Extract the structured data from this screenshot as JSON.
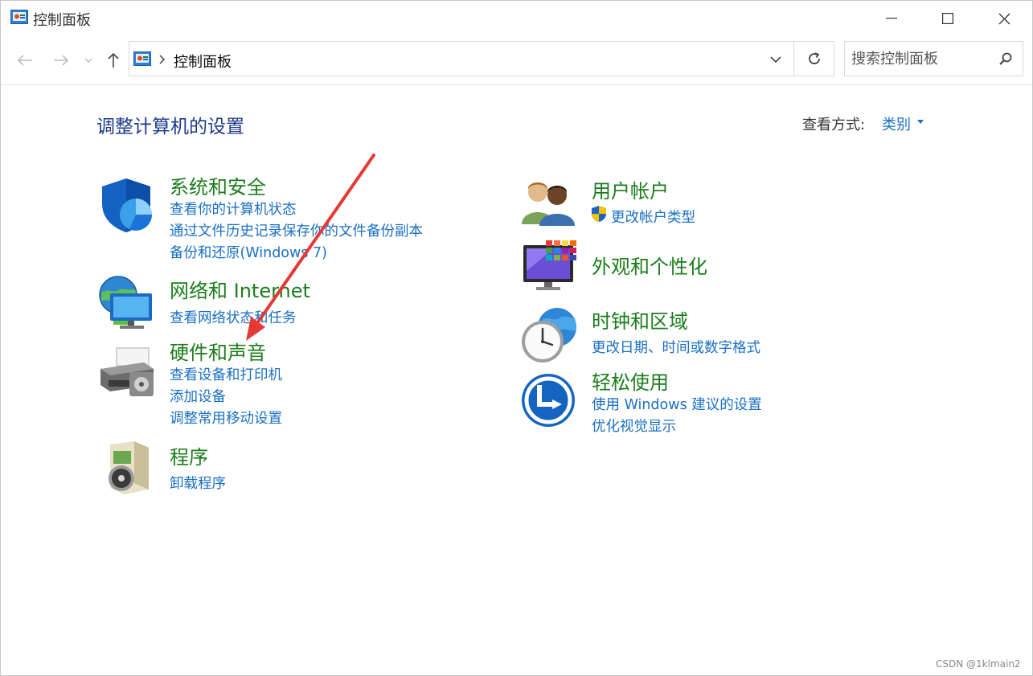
{
  "window": {
    "title": "控制面板",
    "app_icon": "control-panel-icon"
  },
  "nav": {
    "back_icon": "back-arrow-icon",
    "forward_icon": "forward-arrow-icon",
    "history_icon": "chevron-down-icon",
    "up_icon": "up-arrow-icon",
    "address_path": "控制面板",
    "refresh_icon": "refresh-icon",
    "search_placeholder": "搜索控制面板"
  },
  "header": {
    "title": "调整计算机的设置",
    "view_by_label": "查看方式:",
    "view_by_value": "类别"
  },
  "left_categories": [
    {
      "title": "系统和安全",
      "icon": "shield-icon",
      "links": [
        "查看你的计算机状态",
        "通过文件历史记录保存你的文件备份副本",
        "备份和还原(Windows 7)"
      ]
    },
    {
      "title": "网络和 Internet",
      "icon": "network-globe-icon",
      "links": [
        "查看网络状态和任务"
      ]
    },
    {
      "title": "硬件和声音",
      "icon": "printer-icon",
      "links": [
        "查看设备和打印机",
        "添加设备",
        "调整常用移动设置"
      ]
    },
    {
      "title": "程序",
      "icon": "programs-disc-icon",
      "links": [
        "卸载程序"
      ]
    }
  ],
  "right_categories": [
    {
      "title": "用户帐户",
      "icon": "users-icon",
      "links": [
        "更改帐户类型"
      ]
    },
    {
      "title": "外观和个性化",
      "icon": "monitor-palette-icon",
      "links": []
    },
    {
      "title": "时钟和区域",
      "icon": "clock-globe-icon",
      "links": [
        "更改日期、时间或数字格式"
      ]
    },
    {
      "title": "轻松使用",
      "icon": "ease-of-access-icon",
      "links": [
        "使用 Windows 建议的设置",
        "优化视觉显示"
      ]
    }
  ],
  "watermark": "CSDN @1klmain2",
  "colors": {
    "category_title": "#1b7d1b",
    "link": "#1a6fc4",
    "page_title": "#1b3a8a",
    "annotation_arrow": "#e53935"
  }
}
